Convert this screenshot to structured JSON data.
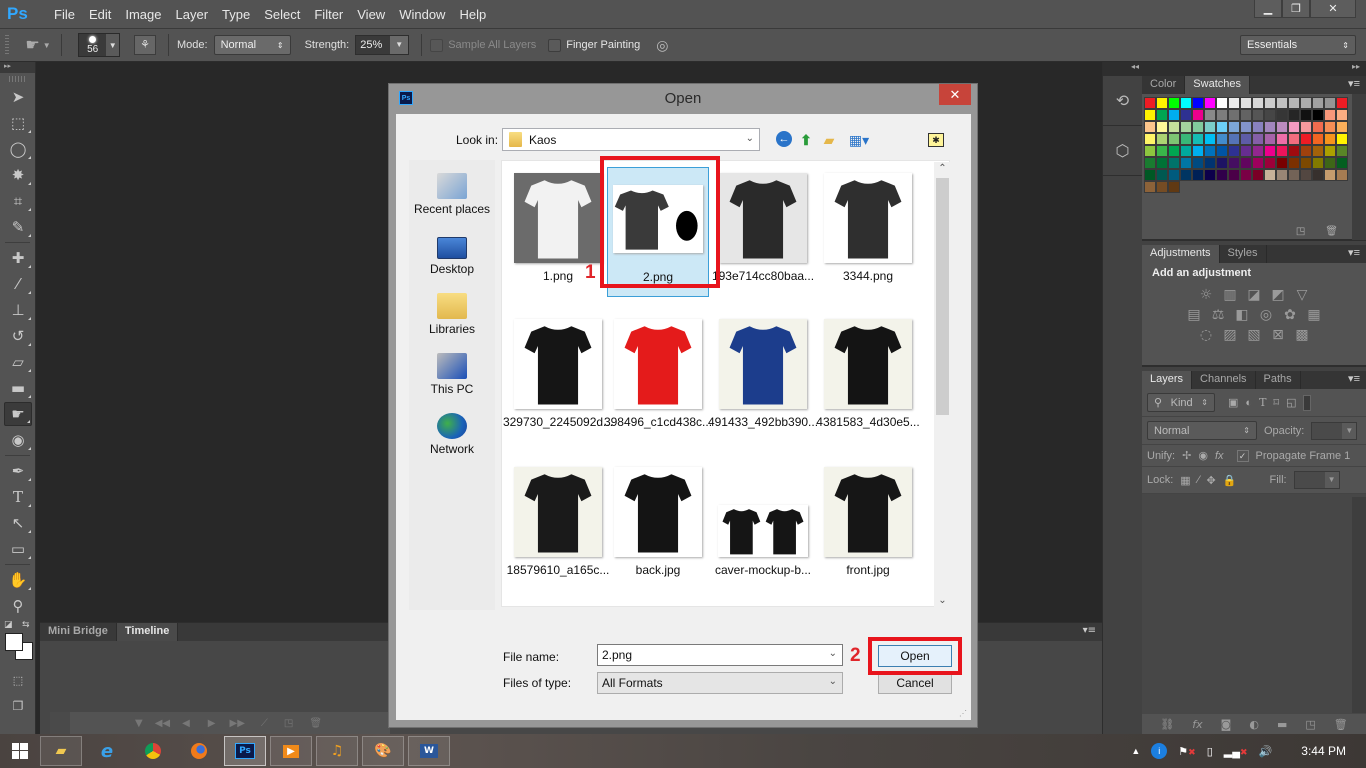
{
  "app": {
    "logo": "Ps",
    "menu": [
      "File",
      "Edit",
      "Image",
      "Layer",
      "Type",
      "Select",
      "Filter",
      "View",
      "Window",
      "Help"
    ],
    "window_controls": {
      "minimize": "▁",
      "restore": "❐",
      "close": "✕"
    }
  },
  "options_bar": {
    "brush_size": "56",
    "mode_label": "Mode:",
    "mode_value": "Normal",
    "strength_label": "Strength:",
    "strength_value": "25%",
    "sample_all_layers": {
      "label": "Sample All Layers",
      "checked": false,
      "enabled": false
    },
    "finger_painting": {
      "label": "Finger Painting",
      "checked": false
    },
    "workspace": "Essentials"
  },
  "toolbar": {
    "tools": [
      "move",
      "rectangular-marquee",
      "lasso",
      "magic-wand",
      "crop",
      "eyedropper",
      "spot-healing-brush",
      "brush",
      "clone-stamp",
      "history-brush",
      "eraser",
      "gradient",
      "smudge",
      "dodge",
      "pen",
      "type",
      "path-selection",
      "rectangle",
      "hand",
      "zoom"
    ],
    "active_tool": "smudge"
  },
  "bottom_panel": {
    "tabs": [
      "Mini Bridge",
      "Timeline"
    ],
    "active_tab": "Timeline"
  },
  "right_panels": {
    "color_tabs": [
      "Color",
      "Swatches"
    ],
    "color_active": "Swatches",
    "swatches": [
      "#ee1c24",
      "#fff200",
      "#00ff00",
      "#00ffff",
      "#0000ff",
      "#ff00ff",
      "#ffffff",
      "#ebebeb",
      "#e1e1e1",
      "#d7d7d7",
      "#cccccc",
      "#c2c2c2",
      "#b7b7b7",
      "#acacac",
      "#a0a0a0",
      "#959595",
      "#ee1c24",
      "#fff200",
      "#00a651",
      "#00aeef",
      "#2e3192",
      "#ec008c",
      "#898989",
      "#7d7d7d",
      "#707070",
      "#636363",
      "#555555",
      "#464646",
      "#363636",
      "#262626",
      "#111111",
      "#000000",
      "#f7977a",
      "#fbad82",
      "#fdc68c",
      "#fff799",
      "#c6df9c",
      "#a4d49d",
      "#81ca9d",
      "#7bcdc9",
      "#6ccff7",
      "#7ca6d8",
      "#8293ca",
      "#8881be",
      "#a286bd",
      "#bc8cbf",
      "#f49bc1",
      "#f5999d",
      "#f26c4f",
      "#f68e55",
      "#fbaf5a",
      "#fff467",
      "#acd372",
      "#7dc473",
      "#39b778",
      "#16bcb4",
      "#00bff3",
      "#438ccb",
      "#5573b7",
      "#5e5ca7",
      "#855fa8",
      "#a763a9",
      "#ef6ea8",
      "#f16d7e",
      "#ee1c24",
      "#f26522",
      "#f7941d",
      "#fff200",
      "#8dc63f",
      "#39b54a",
      "#00a651",
      "#00a99d",
      "#00aeef",
      "#0072bc",
      "#0054a5",
      "#2e3192",
      "#662d91",
      "#92278f",
      "#ec008c",
      "#ed145b",
      "#9e0b0f",
      "#a0410d",
      "#a3620a",
      "#aba000",
      "#598527",
      "#1a7b30",
      "#007236",
      "#00736a",
      "#0076a4",
      "#004a80",
      "#003370",
      "#1d1363",
      "#450e61",
      "#62055f",
      "#9e005d",
      "#9d0039",
      "#790000",
      "#7b3000",
      "#7c4900",
      "#827a00",
      "#3e6617",
      "#045f20",
      "#005824",
      "#005951",
      "#005b7e",
      "#003562",
      "#002056",
      "#0c004b",
      "#30004a",
      "#4b0048",
      "#7a0045",
      "#7a0026",
      "#c7b299",
      "#998675",
      "#736357",
      "#534741",
      "#37302d",
      "#c69c6d",
      "#a67c52",
      "#8c6239",
      "#754c24",
      "#603913"
    ],
    "adjustments_tabs": [
      "Adjustments",
      "Styles"
    ],
    "adjustments_active": "Adjustments",
    "adjustments_title": "Add an adjustment",
    "adjustment_icons": [
      [
        "☼",
        "▥",
        "◪",
        "◩",
        "▽"
      ],
      [
        "▤",
        "⚖",
        "◧",
        "◎",
        "✿",
        "▦"
      ],
      [
        "◌",
        "▨",
        "▧",
        "⊠",
        "▩"
      ]
    ],
    "layers_tabs": [
      "Layers",
      "Channels",
      "Paths"
    ],
    "layers_active": "Layers",
    "kind_filter": "Kind",
    "blend_mode": "Normal",
    "opacity_label": "Opacity:",
    "unify_label": "Unify:",
    "propagate_label": "Propagate Frame 1",
    "propagate_checked": true,
    "lock_label": "Lock:",
    "fill_label": "Fill:"
  },
  "dialog": {
    "title": "Open",
    "look_in_label": "Look in:",
    "look_in_value": "Kaos",
    "places": [
      "Recent places",
      "Desktop",
      "Libraries",
      "This PC",
      "Network"
    ],
    "files": [
      {
        "name": "1.png",
        "shirt": "#f2f2f2",
        "bg": "#6b6b6b"
      },
      {
        "name": "2.png",
        "shirt": "#3a3a3a",
        "bg": "#ffffff",
        "selected": true
      },
      {
        "name": "193e714cc80baa...",
        "shirt": "#2a2a2a",
        "bg": "#e6e6e6"
      },
      {
        "name": "3344.png",
        "shirt": "#2f2f2f",
        "bg": "#ffffff"
      },
      {
        "name": "329730_2245092d...",
        "shirt": "#151515",
        "bg": "#ffffff"
      },
      {
        "name": "398496_c1cd438c...",
        "shirt": "#e41b1b",
        "bg": "#ffffff"
      },
      {
        "name": "491433_492bb390...",
        "shirt": "#1c3d8c",
        "bg": "#f3f3ea"
      },
      {
        "name": "4381583_4d30e5...",
        "shirt": "#141414",
        "bg": "#f3f3ea"
      },
      {
        "name": "18579610_a165c...",
        "shirt": "#1a1a1a",
        "bg": "#f3f3ea"
      },
      {
        "name": "back.jpg",
        "shirt": "#141414",
        "bg": "#ffffff"
      },
      {
        "name": "caver-mockup-b...",
        "shirt": "#151515",
        "bg": "#ffffff"
      },
      {
        "name": "front.jpg",
        "shirt": "#161616",
        "bg": "#f3f3ea"
      }
    ],
    "file_name_label": "File name:",
    "file_name_value": "2.png",
    "file_type_label": "Files of type:",
    "file_type_value": "All Formats",
    "open_label": "Open",
    "cancel_label": "Cancel",
    "annotations": [
      "1",
      "2"
    ],
    "annotation_color": "#e8141c"
  },
  "taskbar": {
    "apps": [
      "File Explorer",
      "Internet Explorer",
      "Chrome",
      "Firefox",
      "Photoshop",
      "Media Player",
      "Music",
      "Paint",
      "Word"
    ],
    "active_app": "Photoshop",
    "clock": "3:44 PM"
  }
}
